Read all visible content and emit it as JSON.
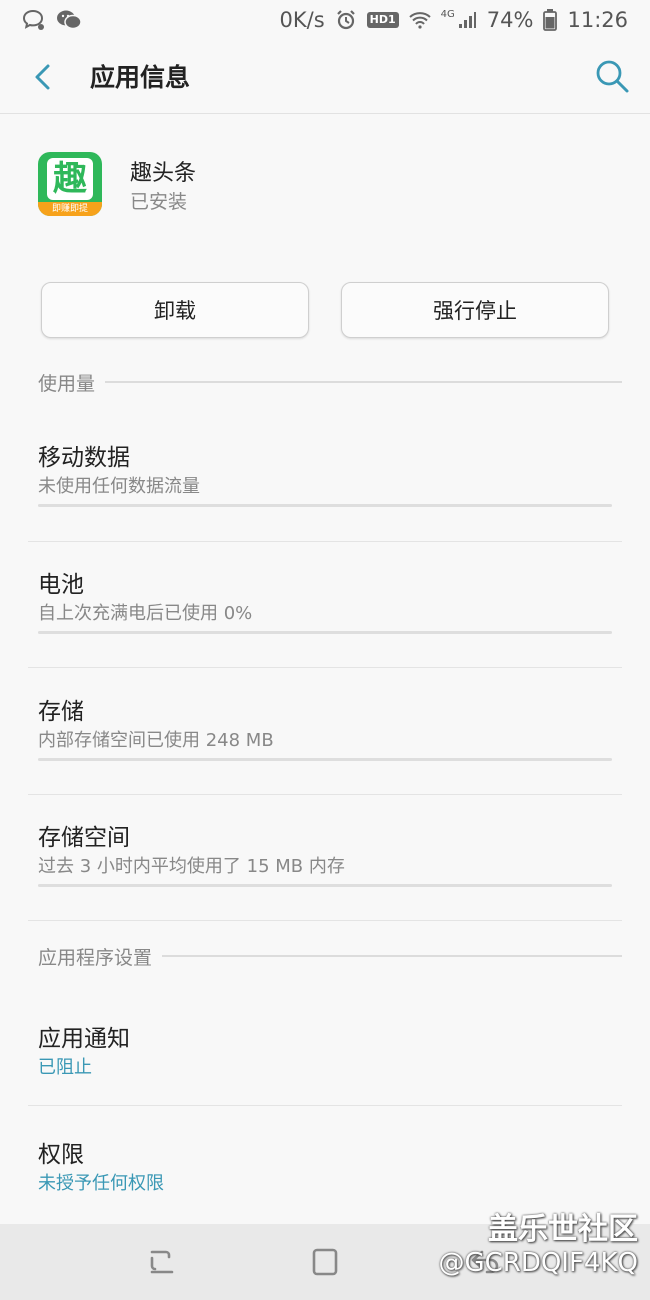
{
  "status_bar": {
    "network_speed": "0K/s",
    "hd_badge": "HD1",
    "network_type": "4G",
    "battery": "74%",
    "time": "11:26"
  },
  "header": {
    "title": "应用信息"
  },
  "app": {
    "name": "趣头条",
    "status": "已安装",
    "icon_glyph": "趣",
    "icon_ribbon": "即赚即提",
    "icon_color": "#2fb85a",
    "ribbon_color": "#f7a21b"
  },
  "buttons": {
    "uninstall": "卸载",
    "force_stop": "强行停止"
  },
  "sections": {
    "usage": "使用量",
    "app_settings": "应用程序设置"
  },
  "usage_items": [
    {
      "title": "移动数据",
      "subtitle": "未使用任何数据流量",
      "progress": 0
    },
    {
      "title": "电池",
      "subtitle": "自上次充满电后已使用 0%",
      "progress": 0
    },
    {
      "title": "存储",
      "subtitle": "内部存储空间已使用 248 MB",
      "progress": 0
    },
    {
      "title": "存储空间",
      "subtitle": "过去 3 小时内平均使用了 15 MB 内存",
      "progress": 0
    }
  ],
  "settings_items": [
    {
      "title": "应用通知",
      "subtitle": "已阻止"
    },
    {
      "title": "权限",
      "subtitle": "未授予任何权限"
    }
  ],
  "accent_color": "#3a98b5",
  "watermark": {
    "line1": "盖乐世社区",
    "line2": "@GCRDQIF4KQ"
  }
}
